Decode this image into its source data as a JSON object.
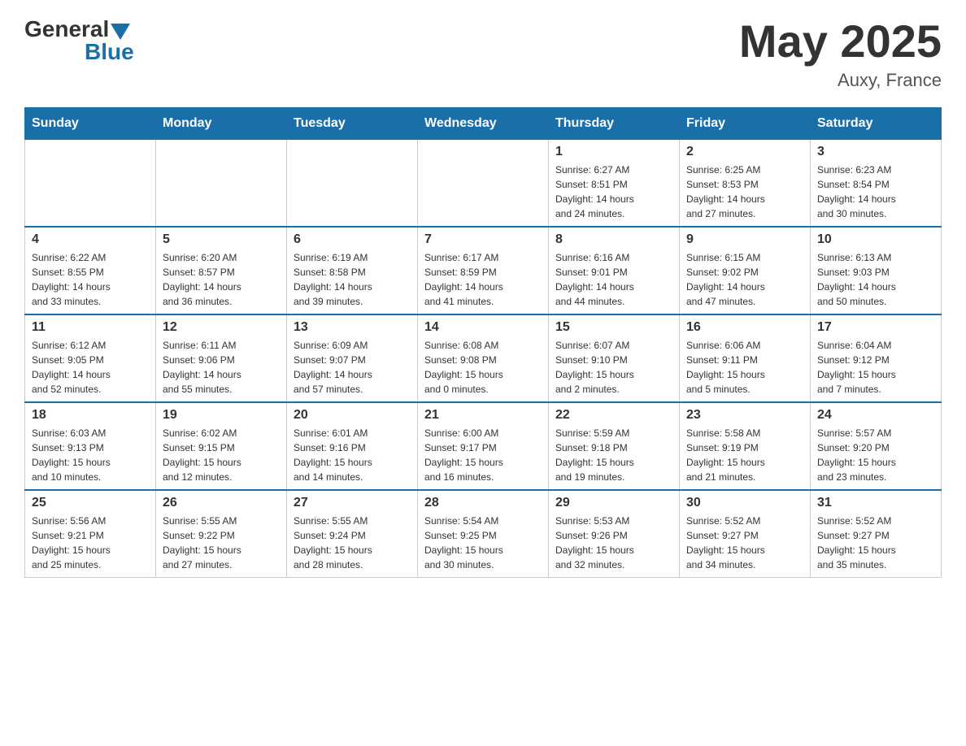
{
  "header": {
    "logo_general": "General",
    "logo_blue": "Blue",
    "month_title": "May 2025",
    "location": "Auxy, France"
  },
  "days_of_week": [
    "Sunday",
    "Monday",
    "Tuesday",
    "Wednesday",
    "Thursday",
    "Friday",
    "Saturday"
  ],
  "weeks": [
    [
      {
        "day": "",
        "info": ""
      },
      {
        "day": "",
        "info": ""
      },
      {
        "day": "",
        "info": ""
      },
      {
        "day": "",
        "info": ""
      },
      {
        "day": "1",
        "info": "Sunrise: 6:27 AM\nSunset: 8:51 PM\nDaylight: 14 hours\nand 24 minutes."
      },
      {
        "day": "2",
        "info": "Sunrise: 6:25 AM\nSunset: 8:53 PM\nDaylight: 14 hours\nand 27 minutes."
      },
      {
        "day": "3",
        "info": "Sunrise: 6:23 AM\nSunset: 8:54 PM\nDaylight: 14 hours\nand 30 minutes."
      }
    ],
    [
      {
        "day": "4",
        "info": "Sunrise: 6:22 AM\nSunset: 8:55 PM\nDaylight: 14 hours\nand 33 minutes."
      },
      {
        "day": "5",
        "info": "Sunrise: 6:20 AM\nSunset: 8:57 PM\nDaylight: 14 hours\nand 36 minutes."
      },
      {
        "day": "6",
        "info": "Sunrise: 6:19 AM\nSunset: 8:58 PM\nDaylight: 14 hours\nand 39 minutes."
      },
      {
        "day": "7",
        "info": "Sunrise: 6:17 AM\nSunset: 8:59 PM\nDaylight: 14 hours\nand 41 minutes."
      },
      {
        "day": "8",
        "info": "Sunrise: 6:16 AM\nSunset: 9:01 PM\nDaylight: 14 hours\nand 44 minutes."
      },
      {
        "day": "9",
        "info": "Sunrise: 6:15 AM\nSunset: 9:02 PM\nDaylight: 14 hours\nand 47 minutes."
      },
      {
        "day": "10",
        "info": "Sunrise: 6:13 AM\nSunset: 9:03 PM\nDaylight: 14 hours\nand 50 minutes."
      }
    ],
    [
      {
        "day": "11",
        "info": "Sunrise: 6:12 AM\nSunset: 9:05 PM\nDaylight: 14 hours\nand 52 minutes."
      },
      {
        "day": "12",
        "info": "Sunrise: 6:11 AM\nSunset: 9:06 PM\nDaylight: 14 hours\nand 55 minutes."
      },
      {
        "day": "13",
        "info": "Sunrise: 6:09 AM\nSunset: 9:07 PM\nDaylight: 14 hours\nand 57 minutes."
      },
      {
        "day": "14",
        "info": "Sunrise: 6:08 AM\nSunset: 9:08 PM\nDaylight: 15 hours\nand 0 minutes."
      },
      {
        "day": "15",
        "info": "Sunrise: 6:07 AM\nSunset: 9:10 PM\nDaylight: 15 hours\nand 2 minutes."
      },
      {
        "day": "16",
        "info": "Sunrise: 6:06 AM\nSunset: 9:11 PM\nDaylight: 15 hours\nand 5 minutes."
      },
      {
        "day": "17",
        "info": "Sunrise: 6:04 AM\nSunset: 9:12 PM\nDaylight: 15 hours\nand 7 minutes."
      }
    ],
    [
      {
        "day": "18",
        "info": "Sunrise: 6:03 AM\nSunset: 9:13 PM\nDaylight: 15 hours\nand 10 minutes."
      },
      {
        "day": "19",
        "info": "Sunrise: 6:02 AM\nSunset: 9:15 PM\nDaylight: 15 hours\nand 12 minutes."
      },
      {
        "day": "20",
        "info": "Sunrise: 6:01 AM\nSunset: 9:16 PM\nDaylight: 15 hours\nand 14 minutes."
      },
      {
        "day": "21",
        "info": "Sunrise: 6:00 AM\nSunset: 9:17 PM\nDaylight: 15 hours\nand 16 minutes."
      },
      {
        "day": "22",
        "info": "Sunrise: 5:59 AM\nSunset: 9:18 PM\nDaylight: 15 hours\nand 19 minutes."
      },
      {
        "day": "23",
        "info": "Sunrise: 5:58 AM\nSunset: 9:19 PM\nDaylight: 15 hours\nand 21 minutes."
      },
      {
        "day": "24",
        "info": "Sunrise: 5:57 AM\nSunset: 9:20 PM\nDaylight: 15 hours\nand 23 minutes."
      }
    ],
    [
      {
        "day": "25",
        "info": "Sunrise: 5:56 AM\nSunset: 9:21 PM\nDaylight: 15 hours\nand 25 minutes."
      },
      {
        "day": "26",
        "info": "Sunrise: 5:55 AM\nSunset: 9:22 PM\nDaylight: 15 hours\nand 27 minutes."
      },
      {
        "day": "27",
        "info": "Sunrise: 5:55 AM\nSunset: 9:24 PM\nDaylight: 15 hours\nand 28 minutes."
      },
      {
        "day": "28",
        "info": "Sunrise: 5:54 AM\nSunset: 9:25 PM\nDaylight: 15 hours\nand 30 minutes."
      },
      {
        "day": "29",
        "info": "Sunrise: 5:53 AM\nSunset: 9:26 PM\nDaylight: 15 hours\nand 32 minutes."
      },
      {
        "day": "30",
        "info": "Sunrise: 5:52 AM\nSunset: 9:27 PM\nDaylight: 15 hours\nand 34 minutes."
      },
      {
        "day": "31",
        "info": "Sunrise: 5:52 AM\nSunset: 9:27 PM\nDaylight: 15 hours\nand 35 minutes."
      }
    ]
  ]
}
